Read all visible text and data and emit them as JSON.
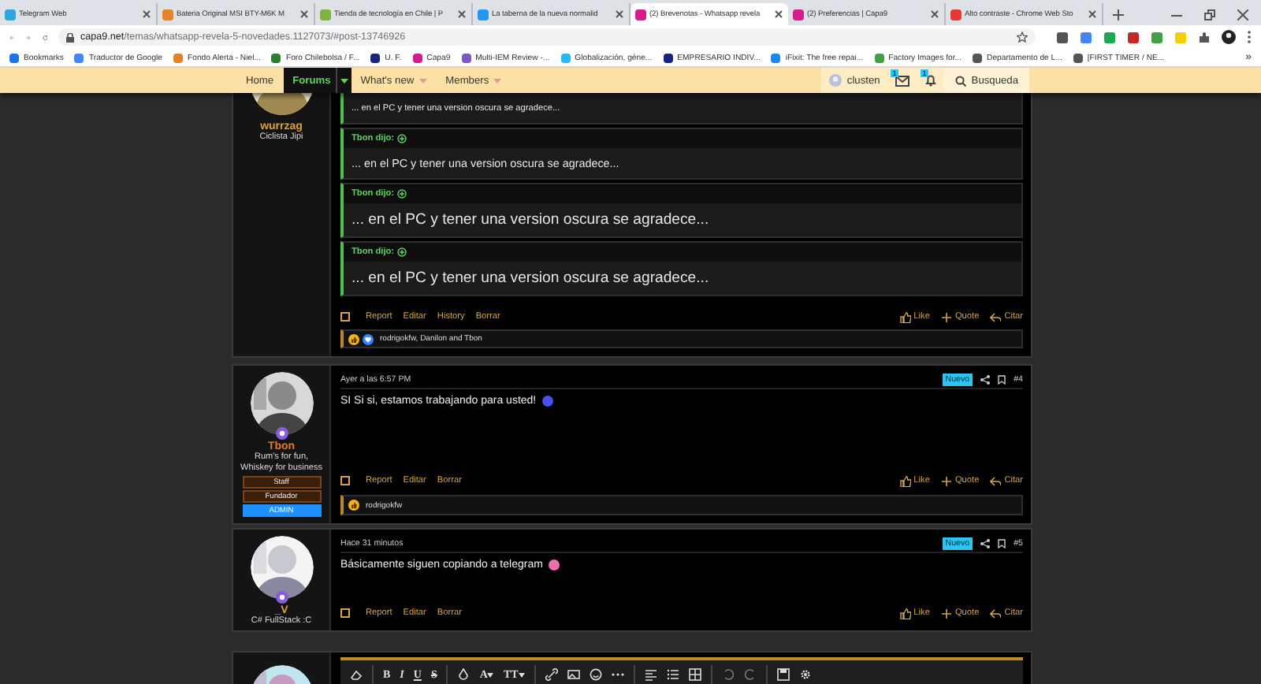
{
  "browser": {
    "tabs": [
      {
        "title": "Telegram Web",
        "selected": false,
        "color": "#2ca5e0"
      },
      {
        "title": "Bateria Original MSI BTY-M6K M",
        "selected": false,
        "color": "#e8822a"
      },
      {
        "title": "Tienda de tecnología en Chile | P",
        "selected": false,
        "color": "#7cb342"
      },
      {
        "title": "La taberna de la nueva normalid",
        "selected": false,
        "color": "#2196f3"
      },
      {
        "title": "(2) Brevenotas - Whatsapp revela",
        "selected": true,
        "color": "#d81b8c"
      },
      {
        "title": "(2) Preferencias | Capa9",
        "selected": false,
        "color": "#d81b8c"
      },
      {
        "title": "Alto contraste - Chrome Web Sto",
        "selected": false,
        "color": "#e53935"
      }
    ],
    "url_host": "capa9.net",
    "url_path": "/temas/whatsapp-revela-5-novedades.1127073/#post-13746926",
    "bookmarks": [
      {
        "label": "Bookmarks",
        "color": "#1a73e8"
      },
      {
        "label": "Traductor de Google",
        "color": "#4285f4"
      },
      {
        "label": "Fondo Alerta - Niel...",
        "color": "#e8822a"
      },
      {
        "label": "Foro Chilebolsa / F...",
        "color": "#2e7d32"
      },
      {
        "label": "U. F.",
        "color": "#1a237e"
      },
      {
        "label": "Capa9",
        "color": "#d81b8c"
      },
      {
        "label": "Multi-IEM Review -...",
        "color": "#7e57c2"
      },
      {
        "label": "Globalización, géne...",
        "color": "#29b6f6"
      },
      {
        "label": "EMPRESARIO INDIV...",
        "color": "#1a237e"
      },
      {
        "label": "iFixit: The free repai...",
        "color": "#1e88e5"
      },
      {
        "label": "Factory Images for...",
        "color": "#43a047"
      },
      {
        "label": "Departamento de L...",
        "color": "#555555"
      },
      {
        "label": "[FIRST TIMER / NE...",
        "color": "#555555"
      }
    ],
    "bookmarks_more": "»"
  },
  "nav": {
    "items": [
      {
        "label": "Home",
        "selected": false,
        "dropdown": false
      },
      {
        "label": "Forums",
        "selected": true,
        "dropdown": true
      },
      {
        "label": "What's new",
        "selected": false,
        "dropdown": true
      },
      {
        "label": "Members",
        "selected": false,
        "dropdown": true
      }
    ],
    "user": "clusten",
    "inbox_badge": "1",
    "alerts_badge": "1",
    "search": "Busqueda"
  },
  "posts": [
    {
      "kind": "continued",
      "user": {
        "name": "wurrzag",
        "color": "#e0a030",
        "title": "Ciclista Jipi"
      },
      "quotes": [
        {
          "body": "... en el PC y tener una version oscura se agradece...",
          "kind": "small"
        },
        {
          "header": "Tbon dijo:",
          "body": "... en el PC y tener una version oscura se agradece...",
          "kind": "medium"
        },
        {
          "header": "Tbon dijo:",
          "body": "... en el PC y tener una version oscura se agradece...",
          "kind": "large"
        },
        {
          "header": "Tbon dijo:",
          "body": "... en el PC y tener una version oscura se agradece...",
          "kind": "large"
        }
      ],
      "selected": false,
      "actions": [
        "Report",
        "Editar",
        "History",
        "Borrar"
      ],
      "reply_actions": [
        {
          "kind": "like",
          "label": "Like"
        },
        {
          "kind": "quote",
          "label": "Quote"
        },
        {
          "kind": "reply",
          "label": "Citar"
        }
      ],
      "reactions": {
        "icons": [
          {
            "kind": "like"
          },
          {
            "kind": "love"
          }
        ],
        "text": "rodrigokfw, Danilon and Tbon"
      }
    },
    {
      "kind": "post",
      "user": {
        "name": "Tbon",
        "color": "#e57a1e",
        "title": "Rum's for fun, Whiskey for business",
        "banners": [
          {
            "label": "Staff",
            "kind": "staff"
          },
          {
            "label": "Fundador",
            "kind": "staff"
          },
          {
            "label": "ADMIN",
            "kind": "admin"
          }
        ]
      },
      "date": "Ayer a las 6:57 PM",
      "badge": "Nuevo",
      "number": "#4",
      "text": "SI Si si, estamos trabajando para usted!",
      "emoji": {
        "color": "#4a4ff0"
      },
      "selected": false,
      "actions": [
        "Report",
        "Editar",
        "Borrar"
      ],
      "reply_actions": [
        {
          "kind": "like",
          "label": "Like"
        },
        {
          "kind": "quote",
          "label": "Quote"
        },
        {
          "kind": "reply",
          "label": "Citar"
        }
      ],
      "reactions": {
        "icons": [
          {
            "kind": "like"
          }
        ],
        "text": "rodrigokfw"
      }
    },
    {
      "kind": "post",
      "user": {
        "name": "_V",
        "color": "#e0a030",
        "title": "C# FullStack :C"
      },
      "date": "Hace 31 minutos",
      "badge": "Nuevo",
      "number": "#5",
      "text": "Básicamente siguen copiando a telegram",
      "emoji": {
        "color": "#f06fb0"
      },
      "selected": false,
      "actions": [
        "Report",
        "Editar",
        "Borrar"
      ],
      "reply_actions": [
        {
          "kind": "like",
          "label": "Like"
        },
        {
          "kind": "quote",
          "label": "Quote"
        },
        {
          "kind": "reply",
          "label": "Citar"
        }
      ]
    },
    {
      "kind": "editor",
      "format_buttons": [
        "B",
        "I",
        "U",
        "S"
      ],
      "font_buttons": [
        "A",
        "TT"
      ]
    }
  ]
}
